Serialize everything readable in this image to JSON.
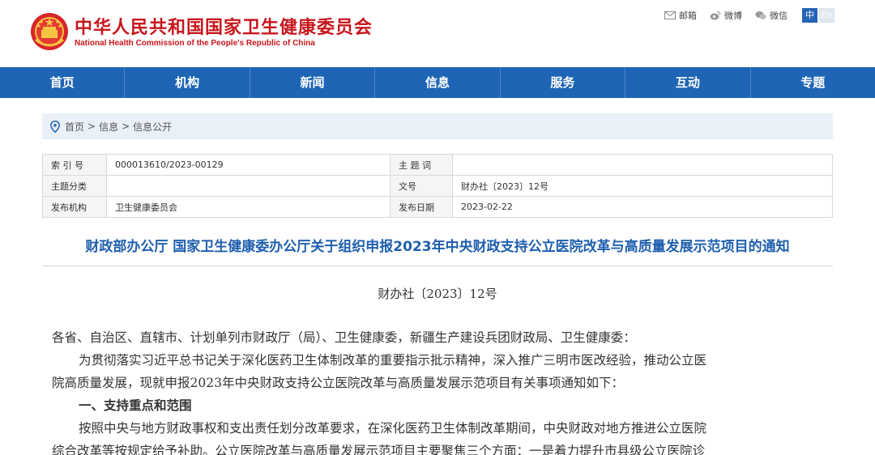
{
  "header": {
    "title_cn": "中华人民共和国国家卫生健康委员会",
    "title_en": "National Health Commission of the People's Republic of China",
    "links": [
      {
        "label": "邮箱",
        "icon": "mail-icon"
      },
      {
        "label": "微博",
        "icon": "weibo-icon"
      },
      {
        "label": "微信",
        "icon": "wechat-icon"
      }
    ],
    "lang_active": "中",
    "lang_inactive": "En"
  },
  "nav": [
    "首页",
    "机构",
    "新闻",
    "信息",
    "服务",
    "互动",
    "专题"
  ],
  "breadcrumb": [
    "首页",
    "信息",
    "信息公开"
  ],
  "meta": {
    "index_label": "索 引 号",
    "index_value": "000013610/2023-00129",
    "subject_label": "主 题 词",
    "subject_value": "",
    "category_label": "主题分类",
    "category_value": "",
    "docno_label": "文号",
    "docno_value": "财办社〔2023〕12号",
    "publisher_label": "发布机构",
    "publisher_value": "卫生健康委员会",
    "date_label": "发布日期",
    "date_value": "2023-02-22"
  },
  "document": {
    "title": "财政部办公厅 国家卫生健康委办公厅关于组织申报2023年中央财政支持公立医院改革与高质量发展示范项目的通知",
    "number": "财办社〔2023〕12号",
    "paragraphs": [
      "各省、自治区、直辖市、计划单列市财政厅（局）、卫生健康委，新疆生产建设兵团财政局、卫生健康委：",
      "为贯彻落实习近平总书记关于深化医药卫生体制改革的重要指示批示精神，深入推广三明市医改经验，推动公立医",
      "院高质量发展，现就申报2023年中央财政支持公立医院改革与高质量发展示范项目有关事项通知如下：",
      "一、支持重点和范围",
      "按照中央与地方财政事权和支出责任划分改革要求，在深化医药卫生体制改革期间，中央财政对地方推进公立医院",
      "综合改革等按规定给予补助。公立医院改革与高质量发展示范项目主要聚焦三个方面：一是着力提升市县级公立医院诊"
    ]
  },
  "colors": {
    "brand_red": "#c8161d",
    "nav_blue": "#1f65b5",
    "title_blue": "#1f5fae"
  }
}
